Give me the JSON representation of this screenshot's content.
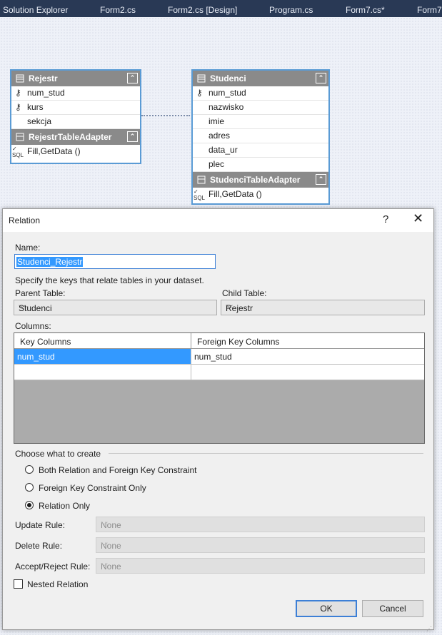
{
  "tabs": [
    "Solution Explorer",
    "Form2.cs",
    "Form2.cs [Design]",
    "Program.cs",
    "Form7.cs*",
    "Form7"
  ],
  "tables": {
    "rejestr": {
      "name": "Rejestr",
      "columns": [
        "num_stud",
        "kurs",
        "sekcja"
      ],
      "adapter": "RejestrTableAdapter",
      "method": "Fill,GetData ()"
    },
    "studenci": {
      "name": "Studenci",
      "columns": [
        "num_stud",
        "nazwisko",
        "imie",
        "adres",
        "data_ur",
        "plec"
      ],
      "adapter": "StudenciTableAdapter",
      "method": "Fill,GetData ()"
    },
    "sql_label": "SQL"
  },
  "dialog": {
    "title": "Relation",
    "help": "?",
    "close": "✕",
    "name_label": "Name:",
    "name_value": "Studenci_Rejestr",
    "instructions": "Specify the keys that relate tables in your dataset.",
    "parent_label": "Parent Table:",
    "parent_value": "Studenci",
    "child_label": "Child Table:",
    "child_value": "Rejestr",
    "columns_label": "Columns:",
    "grid": {
      "headers": [
        "Key Columns",
        "Foreign Key Columns"
      ],
      "rows": [
        [
          "num_stud",
          "num_stud"
        ],
        [
          "",
          ""
        ]
      ]
    },
    "create_label": "Choose what to create",
    "options": [
      "Both Relation and Foreign Key Constraint",
      "Foreign Key Constraint Only",
      "Relation Only"
    ],
    "selected_option": "Relation Only",
    "update_label": "Update Rule:",
    "update_value": "None",
    "delete_label": "Delete Rule:",
    "delete_value": "None",
    "accept_label": "Accept/Reject Rule:",
    "accept_value": "None",
    "nested_label": "Nested Relation",
    "nested_checked": false,
    "ok": "OK",
    "cancel": "Cancel"
  },
  "colors": {
    "tabbar": "#293955",
    "selection": "#3399ff",
    "table_border": "#5a9bd5"
  }
}
